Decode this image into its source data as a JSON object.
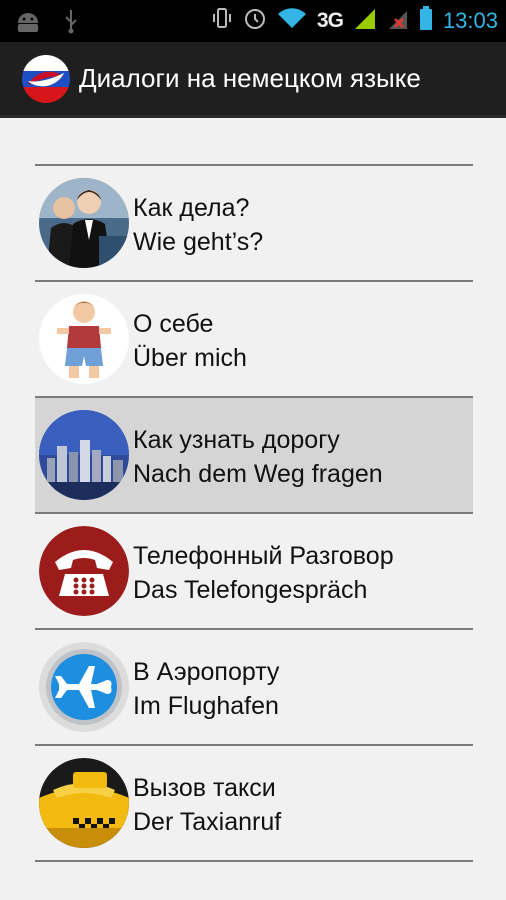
{
  "status_bar": {
    "network": "3G",
    "time": "13:03",
    "icons": [
      "android-icon",
      "usb-icon",
      "vibrate-icon",
      "alarm-icon",
      "wifi-icon",
      "signal-icon",
      "signal-icon",
      "battery-icon"
    ]
  },
  "app": {
    "title": "Диалоги на немецком языке",
    "logo": "russia-flag-logo"
  },
  "dialogs": [
    {
      "ru": "Как дела?",
      "de": "Wie geht’s?",
      "icon": "business-people-icon"
    },
    {
      "ru": "О себе",
      "de": "Über mich",
      "icon": "boy-icon"
    },
    {
      "ru": "Как узнать дорогу",
      "de": "Nach dem Weg fragen",
      "icon": "city-skyline-icon",
      "selected": true
    },
    {
      "ru": "Телефонный Разговор",
      "de": "Das Telefongespräch",
      "icon": "telephone-icon"
    },
    {
      "ru": "В Аэропорту",
      "de": "Im Flughafen",
      "icon": "airplane-icon"
    },
    {
      "ru": "Вызов такси",
      "de": "Der Taxianruf",
      "icon": "taxi-icon"
    }
  ],
  "colors": {
    "status_bar_bg": "#000000",
    "action_bar_bg": "#1f1f1f",
    "clock": "#33b5e5",
    "list_bg": "#f1f1f1",
    "selected_bg": "#d5d5d5"
  }
}
